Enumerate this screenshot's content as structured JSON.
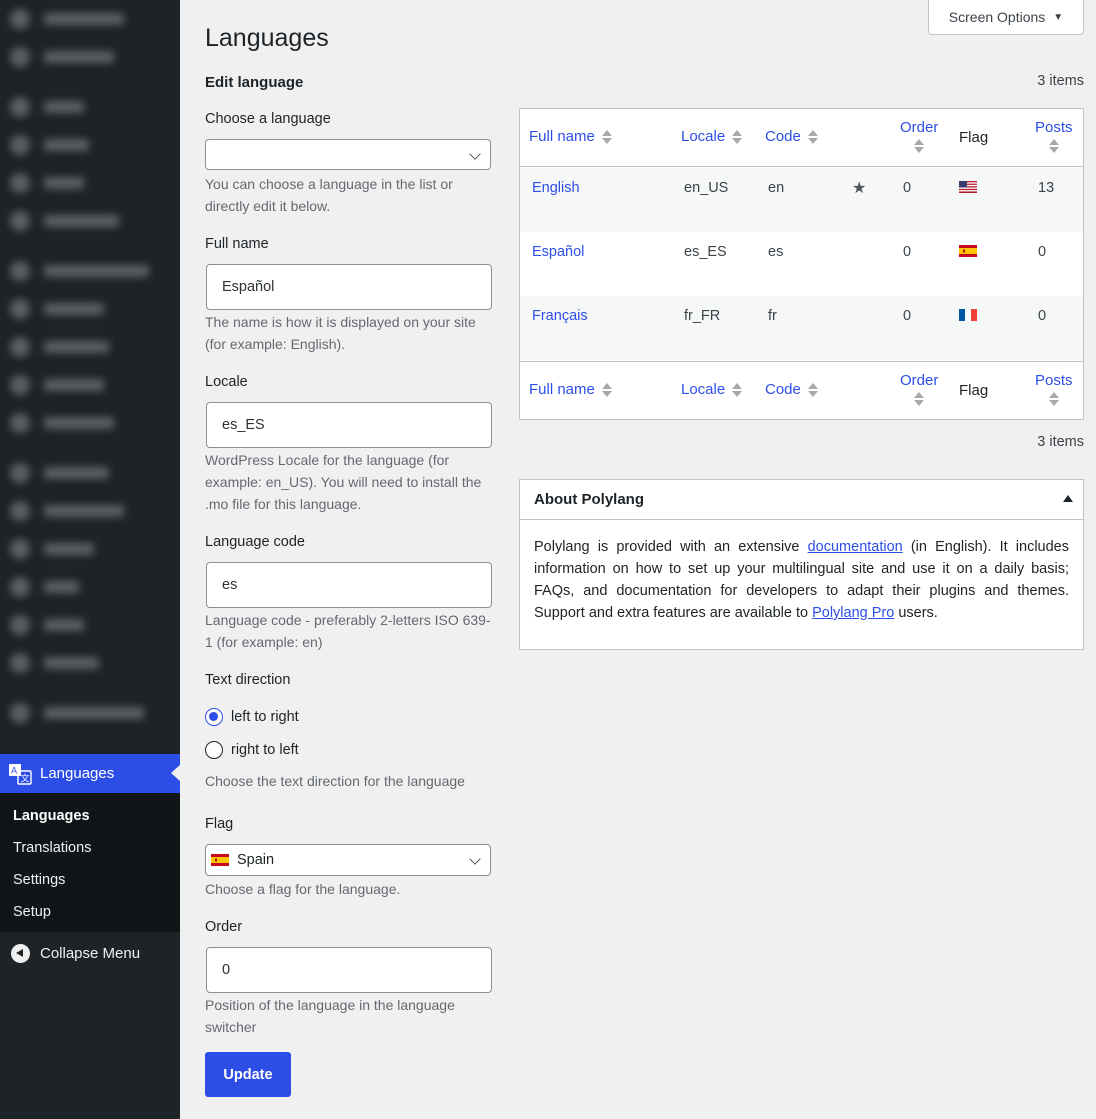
{
  "sidebar": {
    "active_label": "Languages",
    "submenu": [
      "Languages",
      "Translations",
      "Settings",
      "Setup"
    ],
    "collapse_label": "Collapse Menu"
  },
  "header": {
    "screen_options": "Screen Options",
    "page_title": "Languages"
  },
  "form": {
    "heading": "Edit language",
    "choose_label": "Choose a language",
    "choose_value": "",
    "choose_help": "You can choose a language in the list or directly edit it below.",
    "fullname_label": "Full name",
    "fullname_value": "Español",
    "fullname_help": "The name is how it is displayed on your site (for example: English).",
    "locale_label": "Locale",
    "locale_value": "es_ES",
    "locale_help": "WordPress Locale for the language (for example: en_US). You will need to install the .mo file for this language.",
    "code_label": "Language code",
    "code_value": "es",
    "code_help": "Language code - preferably 2-letters ISO 639-1 (for example: en)",
    "direction_label": "Text direction",
    "direction_ltr": "left to right",
    "direction_rtl": "right to left",
    "direction_selected": "ltr",
    "direction_help": "Choose the text direction for the language",
    "flag_label": "Flag",
    "flag_value": "Spain",
    "flag_help": "Choose a flag for the language.",
    "order_label": "Order",
    "order_value": "0",
    "order_help": "Position of the language in the language switcher",
    "submit_label": "Update"
  },
  "table": {
    "items_count": "3 items",
    "columns": {
      "full_name": "Full name",
      "locale": "Locale",
      "code": "Code",
      "order": "Order",
      "flag": "Flag",
      "posts": "Posts"
    },
    "rows": [
      {
        "name": "English",
        "locale": "en_US",
        "code": "en",
        "default": true,
        "order": "0",
        "flag": "us-flag",
        "posts": "13"
      },
      {
        "name": "Español",
        "locale": "es_ES",
        "code": "es",
        "default": false,
        "order": "0",
        "flag": "es-flag",
        "posts": "0"
      },
      {
        "name": "Français",
        "locale": "fr_FR",
        "code": "fr",
        "default": false,
        "order": "0",
        "flag": "fr-flag",
        "posts": "0"
      }
    ]
  },
  "about": {
    "title": "About Polylang",
    "text_1": "Polylang is provided with an extensive ",
    "link_1": "documentation",
    "text_2": " (in English). It includes information on how to set up your multilingual site and use it on a daily basis; FAQs, and documentation for developers to adapt their plugins and themes. Support and extra features are available to ",
    "link_2": "Polylang Pro",
    "text_3": " users."
  },
  "colors": {
    "accent": "#2d4ee6",
    "sidebar_bg": "#1d2327",
    "page_bg": "#f0f0f1"
  }
}
